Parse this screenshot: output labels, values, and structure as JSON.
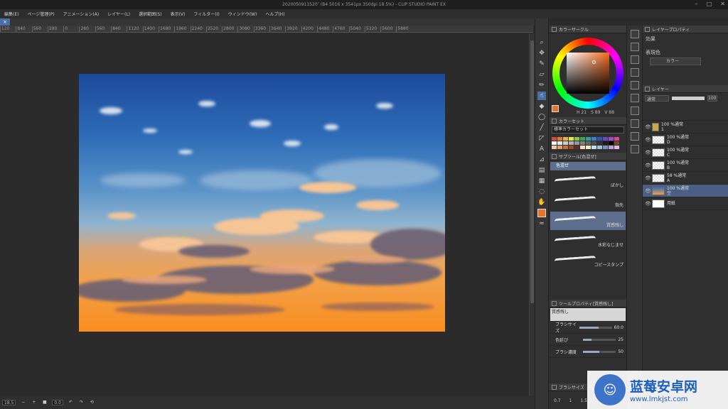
{
  "window": {
    "title": "2020050911520″ (B4 5016 x 3541px 350dpi 18.5%) - CLIP STUDIO PAINT EX",
    "controls": [
      "–",
      "□",
      "✕"
    ]
  },
  "menu": [
    "編集(E)",
    "ページ管理(P)",
    "アニメーション(A)",
    "レイヤー(L)",
    "選択範囲(S)",
    "表示(V)",
    "フィルター(I)",
    "ウィンドウ(W)",
    "ヘルプ(H)"
  ],
  "ruler_ticks": [
    "120",
    "840",
    "560",
    "280",
    "0",
    "280",
    "560",
    "840",
    "1120",
    "1400",
    "1680",
    "1960",
    "2240",
    "2520",
    "2800",
    "3080",
    "3360",
    "3640",
    "3920",
    "4200",
    "4480",
    "4760",
    "5040",
    "5320",
    "5600",
    "5880"
  ],
  "status": {
    "zoom": "18.5",
    "angle": "0.0"
  },
  "panels": {
    "color_wheel": {
      "title": "カラーサークル",
      "hsv": [
        "H 21",
        "S 89",
        "V 88"
      ],
      "fg_color": "#e8732a"
    },
    "color_set": {
      "title": "カラーセット",
      "set_name": "標準カラーセット",
      "swatches": [
        "#d94b3c",
        "#e07a3a",
        "#e8b339",
        "#e9e34c",
        "#8bc34a",
        "#3aa655",
        "#2e9e9e",
        "#3b82c4",
        "#2e55b8",
        "#6a4ac2",
        "#a24bc2",
        "#d34b8f",
        "#ffffff",
        "#e6e6e6",
        "#cccccc",
        "#b3b3b3",
        "#999999",
        "#808080",
        "#666666",
        "#4d4d4d",
        "#333333",
        "#1a1a1a",
        "#000000",
        "#7a4a2a",
        "#f2c9a0",
        "#e0a070",
        "#c07040",
        "#8a5030",
        "#5a3020",
        "#f8d8c0",
        "#f0f0c0",
        "#c0e0f0",
        "#a0c0e0",
        "#8090c0",
        "#c0a0d0",
        "#e0c0e0"
      ]
    },
    "sub_tool": {
      "title": "サブツール[色混ぜ]",
      "group": "色混ぜ",
      "items": [
        "ぼかし",
        "指先",
        "質感残し",
        "水彩なじませ",
        "コピースタンプ"
      ],
      "selected_index": 2
    },
    "tool_property": {
      "title": "ツールプロパティ[質感残し]",
      "brush_name": "質感残し",
      "props": [
        {
          "label": "ブラシサイズ",
          "value": "60.0",
          "fraction": 0.6
        },
        {
          "label": "色延び",
          "value": "25",
          "fraction": 0.25
        },
        {
          "label": "ブラシ濃度",
          "value": "50",
          "fraction": 0.5
        }
      ]
    },
    "brush_size_title": "ブラシサイズ",
    "brush_sizes": [
      "0.7",
      "1",
      "1.5"
    ]
  },
  "effects": {
    "title": "レイヤープロパティ",
    "effect_label": "効果",
    "color_label": "表現色",
    "color_value": "カラー"
  },
  "layers": {
    "title": "レイヤー",
    "blend": "通常",
    "opacity": "100",
    "items": [
      {
        "pct": "100 %通常",
        "name": "1",
        "type": "folder",
        "selected": false
      },
      {
        "pct": "100 %通常",
        "name": "D",
        "type": "raster",
        "selected": false
      },
      {
        "pct": "100 %通常",
        "name": "C",
        "type": "raster",
        "selected": false
      },
      {
        "pct": "100 %通常",
        "name": "B",
        "type": "raster",
        "selected": false
      },
      {
        "pct": "58 %通常",
        "name": "A",
        "type": "raster",
        "selected": false
      },
      {
        "pct": "100 %通常",
        "name": "空",
        "type": "sky",
        "selected": true
      },
      {
        "pct": "",
        "name": "用紙",
        "type": "paper",
        "selected": false
      }
    ]
  },
  "watermark": {
    "title": "蓝莓安卓网",
    "url": "www.lmkjst.com"
  }
}
